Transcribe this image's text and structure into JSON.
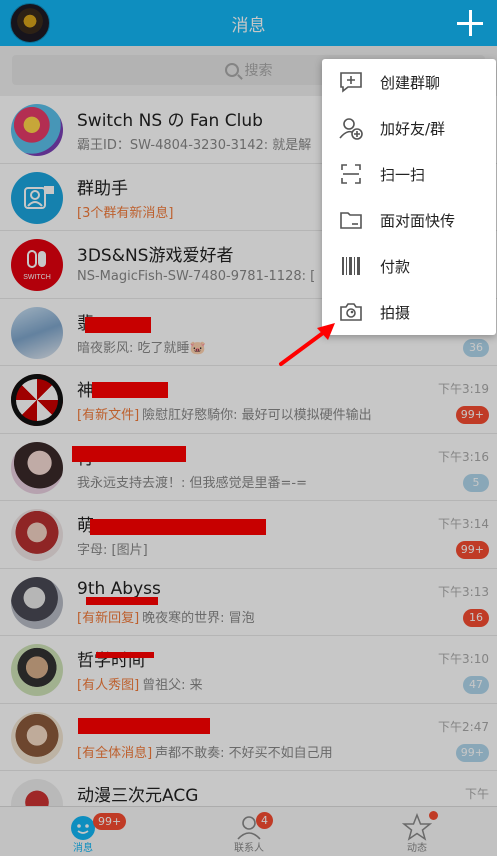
{
  "header": {
    "title": "消息"
  },
  "search": {
    "placeholder": "搜索"
  },
  "conversations": [
    {
      "name": "Switch NS の Fan Club",
      "tag": "",
      "preview": "霸王ID：SW-4804-3230-3142: 就是解",
      "time": "",
      "badge": ""
    },
    {
      "name": "群助手",
      "tag": "[3个群有新消息]",
      "preview": "",
      "time": "",
      "badge": ""
    },
    {
      "name": "3DS&NS游戏爱好者",
      "tag": "",
      "preview": "NS-MagicFish-SW-7480-9781-1128: [",
      "time": "",
      "badge": ""
    },
    {
      "name": "翡",
      "tag": "",
      "preview": "暗夜影风: 吃了就睡🐷",
      "time": "",
      "badge": "36"
    },
    {
      "name": "神",
      "tag": "[有新文件]",
      "preview": "險慰肛好愍騎你: 最好可以模拟硬件输出",
      "time": "下午3:19",
      "badge": "99+"
    },
    {
      "name": "行",
      "tag": "",
      "preview": "我永远支持去渡！: 但我感觉是里番=-=",
      "time": "下午3:16",
      "badge": "5"
    },
    {
      "name": "萌",
      "tag": "",
      "preview": "字母: [图片]",
      "time": "下午3:14",
      "badge": "99+"
    },
    {
      "name": "9th Abyss",
      "tag": "[有新回复]",
      "preview": "晚夜寒的世界: 冒泡",
      "time": "下午3:13",
      "badge": "16"
    },
    {
      "name": "哲学时间",
      "tag": "[有人秀图]",
      "preview": "曾祖父: 来",
      "time": "下午3:10",
      "badge": "47"
    },
    {
      "name": "",
      "tag": "[有全体消息]",
      "preview": "声都不敢奏: 不好买不如自己用",
      "time": "下午2:47",
      "badge": "99+"
    },
    {
      "name": "动漫三次元ACG",
      "tag": "",
      "preview": "",
      "time": "下午",
      "badge": ""
    }
  ],
  "menu": {
    "items": [
      {
        "label": "创建群聊",
        "icon": "create-group-icon"
      },
      {
        "label": "加好友/群",
        "icon": "add-friend-icon"
      },
      {
        "label": "扫一扫",
        "icon": "scan-icon"
      },
      {
        "label": "面对面快传",
        "icon": "folder-transfer-icon"
      },
      {
        "label": "付款",
        "icon": "barcode-icon"
      },
      {
        "label": "拍摄",
        "icon": "camera-icon"
      }
    ]
  },
  "tabs": [
    {
      "label": "消息",
      "badge": "99+"
    },
    {
      "label": "联系人",
      "badge": "4"
    },
    {
      "label": "动态",
      "badge": ""
    }
  ],
  "colors": {
    "accent": "#12b7f5",
    "badge_red": "#f74c31",
    "badge_muted": "#b0d7ec",
    "tag_orange": "#f37b3b",
    "annotation": "#ff0000"
  }
}
